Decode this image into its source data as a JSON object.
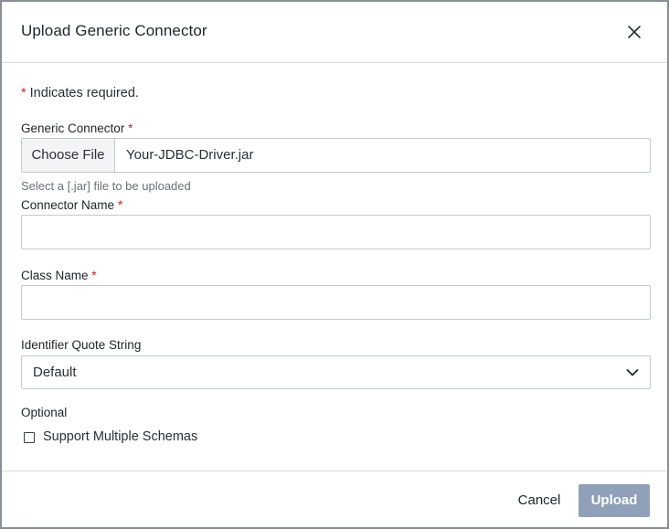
{
  "dialog": {
    "title": "Upload Generic Connector",
    "close_icon": "close-icon"
  },
  "form": {
    "required_asterisk": "*",
    "required_note": "Indicates required.",
    "generic_connector": {
      "label": "Generic Connector",
      "choose_file_label": "Choose File",
      "file_name": "Your-JDBC-Driver.jar",
      "hint": "Select a [.jar] file to be uploaded"
    },
    "connector_name": {
      "label": "Connector Name",
      "value": ""
    },
    "class_name": {
      "label": "Class Name",
      "value": ""
    },
    "identifier_quote_string": {
      "label": "Identifier Quote String",
      "selected": "Default",
      "chevron_icon": "chevron-down-icon"
    },
    "optional": {
      "label": "Optional",
      "support_multiple_schemas": {
        "label": "Support Multiple Schemas",
        "checked": false
      }
    }
  },
  "footer": {
    "cancel_label": "Cancel",
    "upload_label": "Upload"
  },
  "colors": {
    "required": "#c0262d",
    "upload_disabled": "#8fa0b8",
    "border": "#c4c8cd"
  }
}
